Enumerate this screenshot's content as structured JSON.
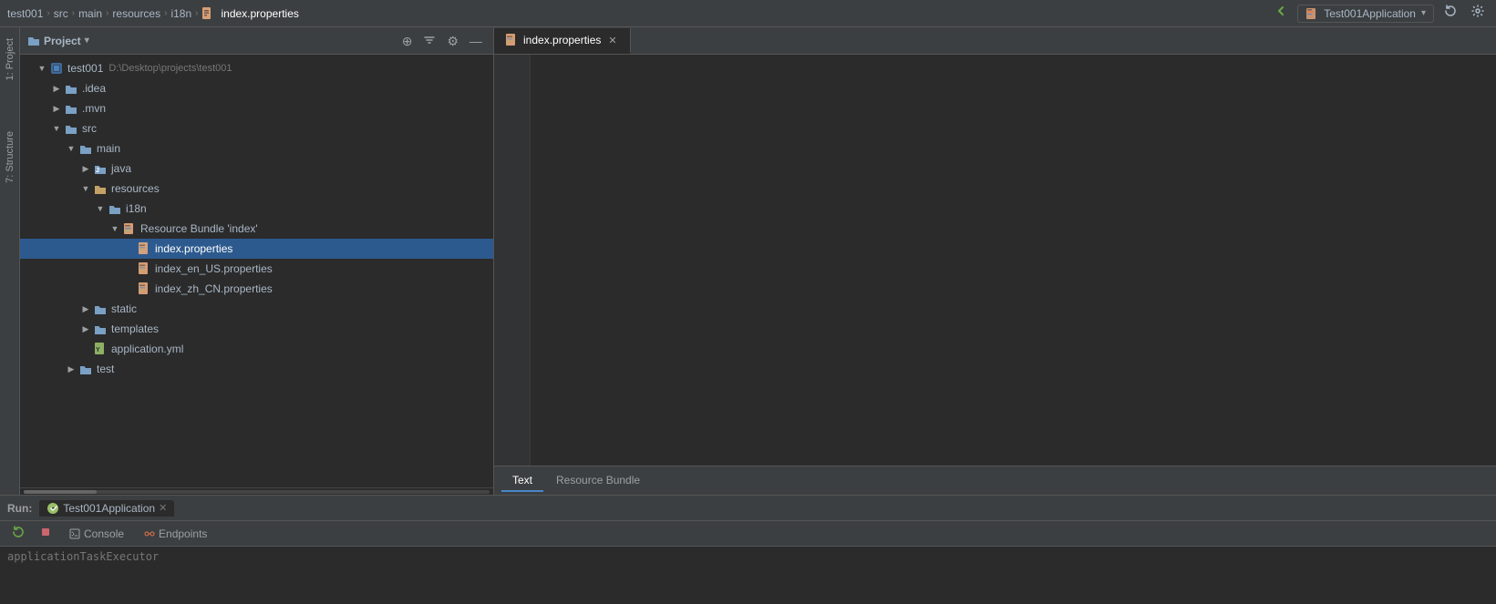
{
  "topBar": {
    "breadcrumb": [
      "test001",
      "src",
      "main",
      "resources",
      "i18n",
      "index.properties"
    ],
    "breadcrumbSeparator": "›",
    "runConfig": "Test001Application",
    "backBtn": "◀",
    "forwardBtn": "▶",
    "runIcon": "▶",
    "settingsIcon": "⚙"
  },
  "projectPanel": {
    "title": "Project",
    "titleIcon": "▾",
    "actions": {
      "addIcon": "⊕",
      "collapseIcon": "⇈",
      "settingsIcon": "⚙",
      "hideIcon": "—"
    },
    "tree": [
      {
        "id": "test001-root",
        "label": "test001",
        "sublabel": "D:\\Desktop\\projects\\test001",
        "indent": 0,
        "arrow": "▼",
        "iconType": "module",
        "selected": false
      },
      {
        "id": "idea",
        "label": ".idea",
        "indent": 1,
        "arrow": "▶",
        "iconType": "folder",
        "selected": false
      },
      {
        "id": "mvn",
        "label": ".mvn",
        "indent": 1,
        "arrow": "▶",
        "iconType": "folder",
        "selected": false
      },
      {
        "id": "src",
        "label": "src",
        "indent": 1,
        "arrow": "▼",
        "iconType": "folder",
        "selected": false
      },
      {
        "id": "main",
        "label": "main",
        "indent": 2,
        "arrow": "▼",
        "iconType": "folder",
        "selected": false
      },
      {
        "id": "java",
        "label": "java",
        "indent": 3,
        "arrow": "▶",
        "iconType": "folder-src",
        "selected": false
      },
      {
        "id": "resources",
        "label": "resources",
        "indent": 3,
        "arrow": "▼",
        "iconType": "folder-res",
        "selected": false
      },
      {
        "id": "i18n",
        "label": "i18n",
        "indent": 4,
        "arrow": "▼",
        "iconType": "folder",
        "selected": false
      },
      {
        "id": "resource-bundle",
        "label": "Resource Bundle 'index'",
        "indent": 5,
        "arrow": "▼",
        "iconType": "resource-bundle",
        "selected": false
      },
      {
        "id": "index.properties",
        "label": "index.properties",
        "indent": 6,
        "arrow": "",
        "iconType": "properties",
        "selected": true
      },
      {
        "id": "index_en_US.properties",
        "label": "index_en_US.properties",
        "indent": 6,
        "arrow": "",
        "iconType": "properties",
        "selected": false
      },
      {
        "id": "index_zh_CN.properties",
        "label": "index_zh_CN.properties",
        "indent": 6,
        "arrow": "",
        "iconType": "properties",
        "selected": false
      },
      {
        "id": "static",
        "label": "static",
        "indent": 3,
        "arrow": "▶",
        "iconType": "folder",
        "selected": false
      },
      {
        "id": "templates",
        "label": "templates",
        "indent": 3,
        "arrow": "▶",
        "iconType": "folder",
        "selected": false
      },
      {
        "id": "application.yml",
        "label": "application.yml",
        "indent": 3,
        "arrow": "",
        "iconType": "yaml",
        "selected": false
      },
      {
        "id": "test",
        "label": "test",
        "indent": 2,
        "arrow": "▶",
        "iconType": "folder",
        "selected": false
      }
    ]
  },
  "editor": {
    "tabs": [
      {
        "id": "index-props",
        "label": "index.properties",
        "active": true,
        "closable": true
      }
    ],
    "bottomTabs": [
      {
        "id": "text",
        "label": "Text",
        "active": true
      },
      {
        "id": "resource-bundle",
        "label": "Resource Bundle",
        "active": false
      }
    ]
  },
  "runPanel": {
    "runLabel": "Run:",
    "appName": "Test001Application",
    "tabs": [
      {
        "id": "console",
        "label": "Console",
        "iconType": "console"
      },
      {
        "id": "endpoints",
        "label": "Endpoints",
        "iconType": "endpoints"
      }
    ],
    "consoleText": "applicationTaskExecutor"
  }
}
